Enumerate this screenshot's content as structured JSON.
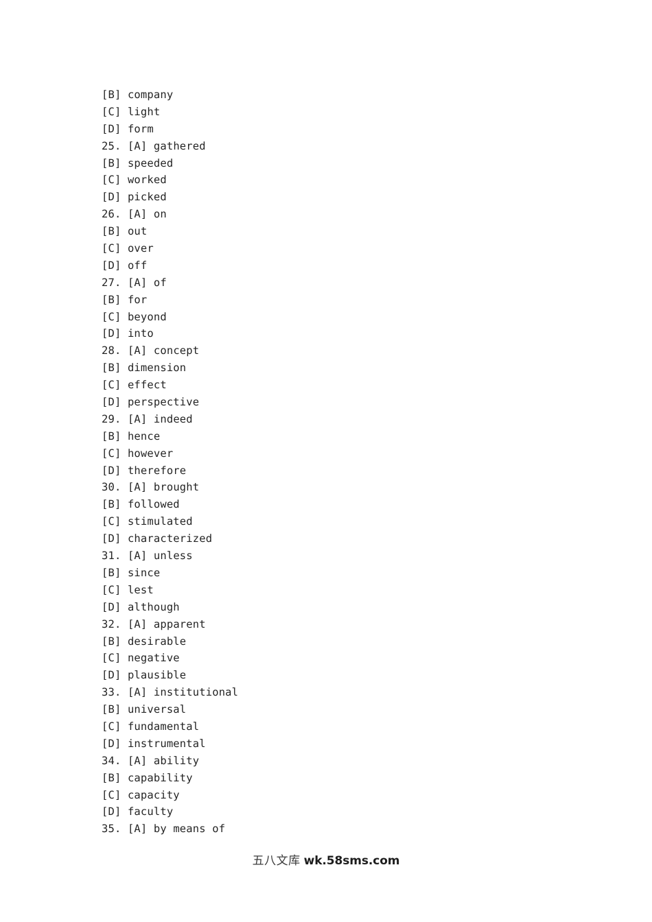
{
  "page": {
    "background_color": "#ffffff",
    "text_color": "#242424"
  },
  "document": {
    "lines": [
      {
        "number": "",
        "tag": "[B]",
        "word": "company"
      },
      {
        "number": "",
        "tag": "[C]",
        "word": "light"
      },
      {
        "number": "",
        "tag": "[D]",
        "word": "form"
      },
      {
        "number": "25.",
        "tag": "[A]",
        "word": "gathered"
      },
      {
        "number": "",
        "tag": "[B]",
        "word": "speeded"
      },
      {
        "number": "",
        "tag": "[C]",
        "word": "worked"
      },
      {
        "number": "",
        "tag": "[D]",
        "word": "picked"
      },
      {
        "number": "26.",
        "tag": "[A]",
        "word": "on"
      },
      {
        "number": "",
        "tag": "[B]",
        "word": "out"
      },
      {
        "number": "",
        "tag": "[C]",
        "word": "over"
      },
      {
        "number": "",
        "tag": "[D]",
        "word": "off"
      },
      {
        "number": "27.",
        "tag": "[A]",
        "word": "of"
      },
      {
        "number": "",
        "tag": "[B]",
        "word": "for"
      },
      {
        "number": "",
        "tag": "[C]",
        "word": "beyond"
      },
      {
        "number": "",
        "tag": "[D]",
        "word": "into"
      },
      {
        "number": "28.",
        "tag": "[A]",
        "word": "concept"
      },
      {
        "number": "",
        "tag": "[B]",
        "word": "dimension"
      },
      {
        "number": "",
        "tag": "[C]",
        "word": "effect"
      },
      {
        "number": "",
        "tag": "[D]",
        "word": "perspective"
      },
      {
        "number": "29.",
        "tag": "[A]",
        "word": "indeed"
      },
      {
        "number": "",
        "tag": "[B]",
        "word": "hence"
      },
      {
        "number": "",
        "tag": "[C]",
        "word": "however"
      },
      {
        "number": "",
        "tag": "[D]",
        "word": "therefore"
      },
      {
        "number": "30.",
        "tag": "[A]",
        "word": "brought"
      },
      {
        "number": "",
        "tag": "[B]",
        "word": "followed"
      },
      {
        "number": "",
        "tag": "[C]",
        "word": "stimulated"
      },
      {
        "number": "",
        "tag": "[D]",
        "word": "characterized"
      },
      {
        "number": "31.",
        "tag": "[A]",
        "word": "unless"
      },
      {
        "number": "",
        "tag": "[B]",
        "word": "since"
      },
      {
        "number": "",
        "tag": "[C]",
        "word": "lest"
      },
      {
        "number": "",
        "tag": "[D]",
        "word": "although"
      },
      {
        "number": "32.",
        "tag": "[A]",
        "word": "apparent"
      },
      {
        "number": "",
        "tag": "[B]",
        "word": "desirable"
      },
      {
        "number": "",
        "tag": "[C]",
        "word": "negative"
      },
      {
        "number": "",
        "tag": "[D]",
        "word": "plausible"
      },
      {
        "number": "33.",
        "tag": "[A]",
        "word": "institutional"
      },
      {
        "number": "",
        "tag": "[B]",
        "word": "universal"
      },
      {
        "number": "",
        "tag": "[C]",
        "word": "fundamental"
      },
      {
        "number": "",
        "tag": "[D]",
        "word": "instrumental"
      },
      {
        "number": "34.",
        "tag": "[A]",
        "word": "ability"
      },
      {
        "number": "",
        "tag": "[B]",
        "word": "capability"
      },
      {
        "number": "",
        "tag": "[C]",
        "word": "capacity"
      },
      {
        "number": "",
        "tag": "[D]",
        "word": "faculty"
      },
      {
        "number": "35.",
        "tag": "[A]",
        "word": "by means of"
      }
    ]
  },
  "watermark": {
    "site_name": "五八文库",
    "url": "wk.58sms.com"
  }
}
